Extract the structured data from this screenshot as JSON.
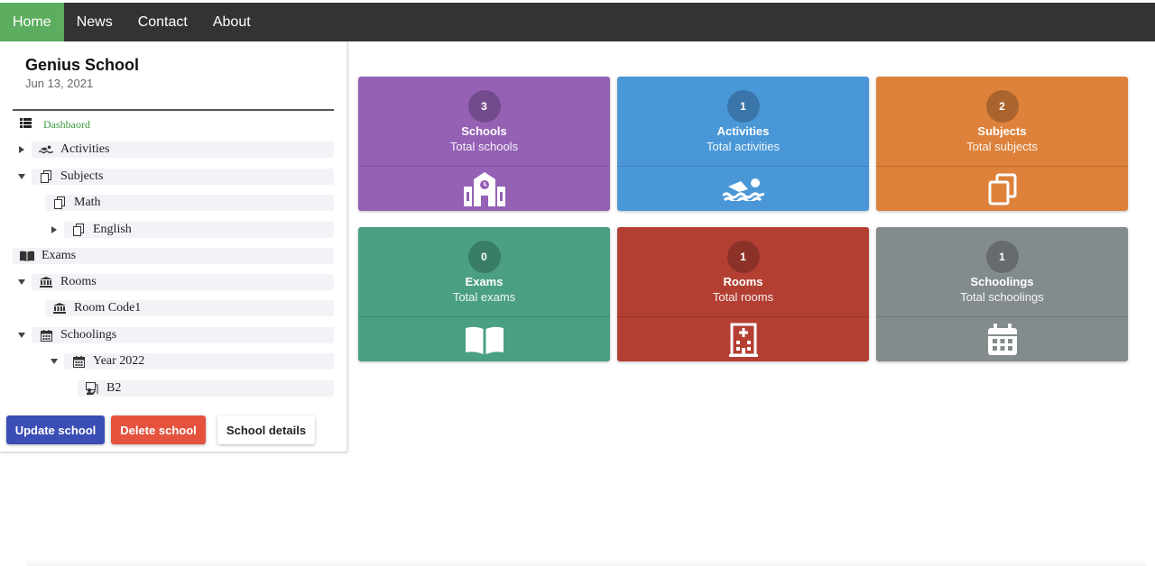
{
  "nav": {
    "items": [
      {
        "label": "Home",
        "active": true
      },
      {
        "label": "News"
      },
      {
        "label": "Contact"
      },
      {
        "label": "About"
      }
    ]
  },
  "school": {
    "name": "Genius School",
    "date": "Jun 13, 2021"
  },
  "tree": {
    "dashboard": "Dashbaord",
    "activities": "Activities",
    "subjects": "Subjects",
    "math": "Math",
    "english": "English",
    "exams": "Exams",
    "rooms": "Rooms",
    "room_code": "Room Code1",
    "schoolings": "Schoolings",
    "year": "Year 2022",
    "b2": "B2"
  },
  "buttons": {
    "update": "Update school",
    "delete": "Delete school",
    "details": "School details"
  },
  "cards": [
    {
      "count": "3",
      "title": "Schools",
      "subtitle": "Total schools",
      "color": "#9461b5",
      "icon": "school-icon"
    },
    {
      "count": "1",
      "title": "Activities",
      "subtitle": "Total activities",
      "color": "#4a97d8",
      "icon": "swimmer-icon"
    },
    {
      "count": "2",
      "title": "Subjects",
      "subtitle": "Total subjects",
      "color": "#dd813b",
      "icon": "copy-icon"
    },
    {
      "count": "0",
      "title": "Exams",
      "subtitle": "Total exams",
      "color": "#4a9f84",
      "icon": "book-open-icon"
    },
    {
      "count": "1",
      "title": "Rooms",
      "subtitle": "Total rooms",
      "color": "#b33f33",
      "icon": "hospital-icon"
    },
    {
      "count": "1",
      "title": "Schoolings",
      "subtitle": "Total schoolings",
      "color": "#838b8d",
      "icon": "calendar-icon"
    }
  ]
}
